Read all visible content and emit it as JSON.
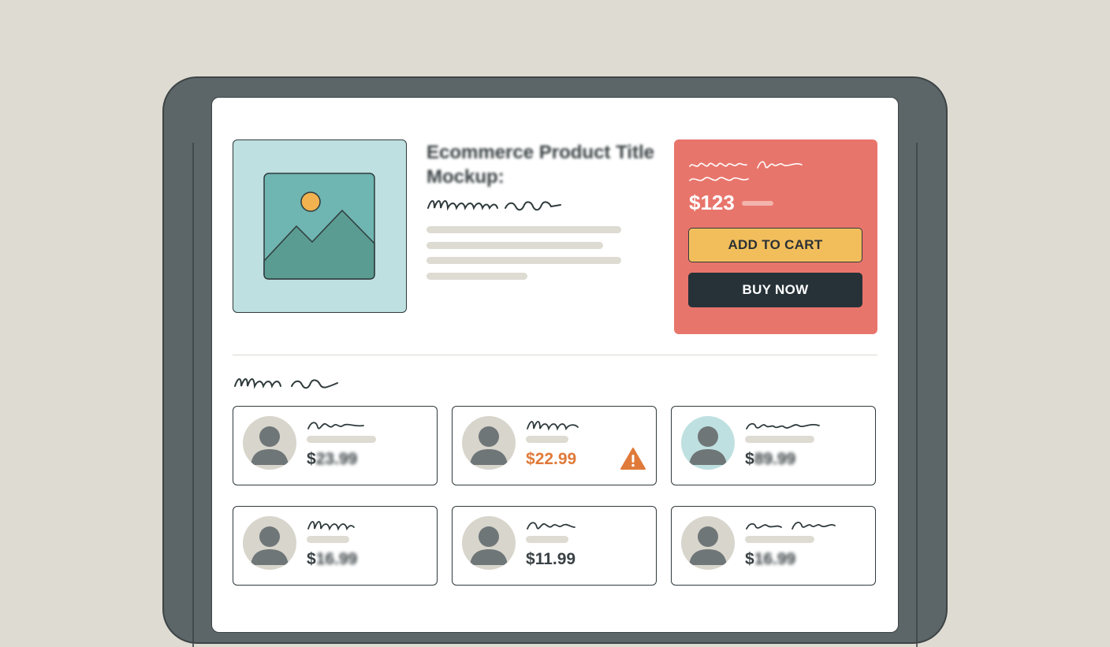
{
  "product": {
    "title": "Ecommerce Product Title Mockup:",
    "image_icon": "image-placeholder-icon"
  },
  "purchase": {
    "price": "$123",
    "add_to_cart_label": "ADD TO CART",
    "buy_now_label": "BUY NOW"
  },
  "related": {
    "items": [
      {
        "dollar": "$",
        "amount": "23.99",
        "amount_blurred": true,
        "warning": false,
        "avatar_bg": "#d8d5cc"
      },
      {
        "dollar": "$",
        "amount": "22.99",
        "amount_blurred": false,
        "warning": true,
        "warning_icon": "warning-triangle-icon",
        "price_color": "#e07a3a",
        "avatar_bg": "#d8d5cc"
      },
      {
        "dollar": "$",
        "amount": "89.99",
        "amount_blurred": true,
        "warning": false,
        "avatar_bg": "#bfe0e0"
      },
      {
        "dollar": "$",
        "amount": "16.99",
        "amount_blurred": true,
        "warning": false,
        "avatar_bg": "#d8d5cc"
      },
      {
        "dollar": "$",
        "amount": "11.99",
        "amount_blurred": false,
        "warning": false,
        "avatar_bg": "#d8d5cc"
      },
      {
        "dollar": "$",
        "amount": "16.99",
        "amount_blurred": true,
        "warning": false,
        "avatar_bg": "#d8d5cc"
      }
    ]
  },
  "colors": {
    "background": "#dedbd2",
    "device_frame": "#5c6567",
    "price_panel": "#e8756b",
    "add_to_cart": "#f2be5c",
    "buy_now": "#263238",
    "warning": "#e07a3a",
    "image_bg": "#bfe0e0"
  }
}
